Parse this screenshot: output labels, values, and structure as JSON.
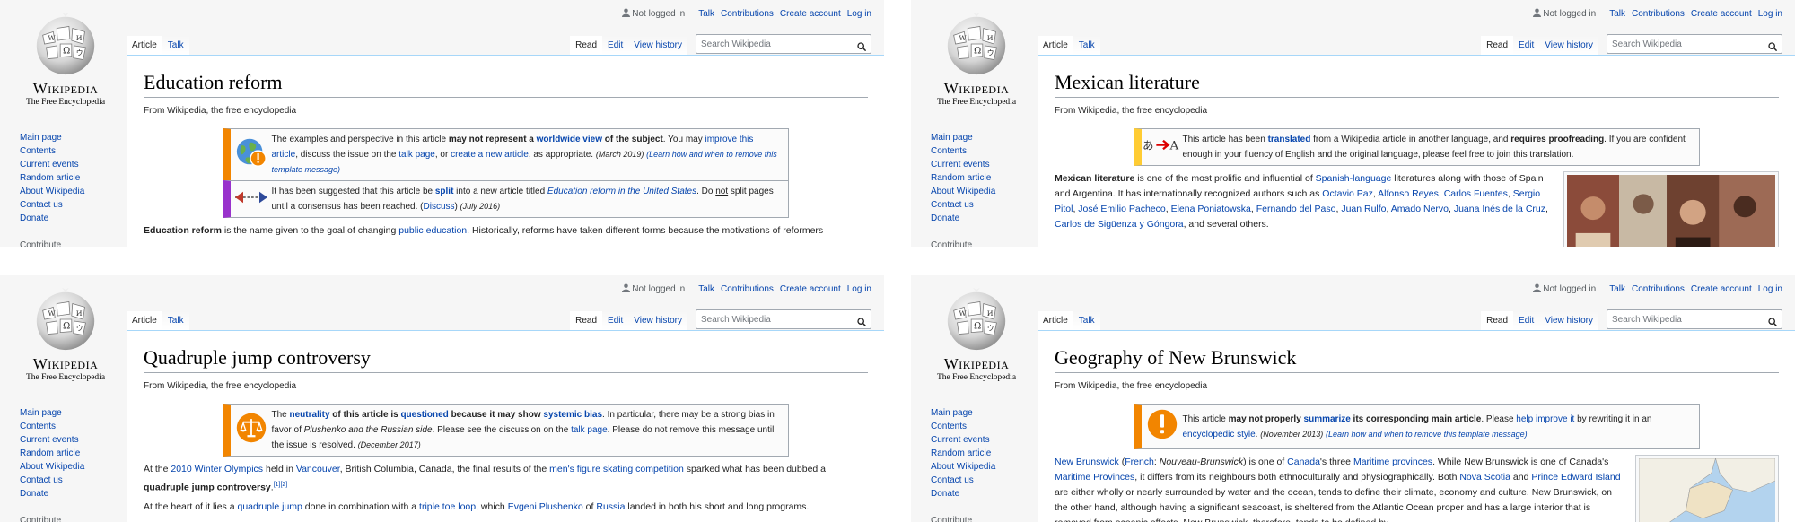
{
  "common": {
    "wordmark": "Wikipedia",
    "tagline": "The Free Encyclopedia",
    "sidebar": {
      "links": [
        "Main page",
        "Contents",
        "Current events",
        "Random article",
        "About Wikipedia",
        "Contact us",
        "Donate"
      ],
      "section": "Contribute"
    },
    "personal": {
      "not_logged": "Not logged in",
      "talk": "Talk",
      "contributions": "Contributions",
      "create_account": "Create account",
      "log_in": "Log in"
    },
    "tabs": {
      "article": "Article",
      "talk": "Talk",
      "read": "Read",
      "edit": "Edit",
      "view_history": "View history"
    },
    "search_placeholder": "Search Wikipedia",
    "site_sub": "From Wikipedia, the free encyclopedia"
  },
  "panels": [
    {
      "title": "Education reform",
      "notices": [
        {
          "icon": "globe-warning-icon",
          "runs": [
            {
              "t": "The examples and perspective in this article "
            },
            {
              "t": "may not represent a ",
              "s": "b"
            },
            {
              "t": "worldwide view",
              "s": "bl"
            },
            {
              "t": " of the subject",
              "s": "b"
            },
            {
              "t": ". You may "
            },
            {
              "t": "improve this article",
              "s": "l"
            },
            {
              "t": ", discuss the issue on the "
            },
            {
              "t": "talk page",
              "s": "l"
            },
            {
              "t": ", or "
            },
            {
              "t": "create a new article",
              "s": "l"
            },
            {
              "t": ", as appropriate. "
            },
            {
              "t": "(March 2019)",
              "s": "d"
            },
            {
              "t": " "
            },
            {
              "t": "(Learn how and when to remove this template message)",
              "s": "ld"
            }
          ]
        },
        {
          "icon": "split-arrows-icon",
          "type": "move",
          "runs": [
            {
              "t": "It has been suggested that this article be "
            },
            {
              "t": "split",
              "s": "bl"
            },
            {
              "t": " into a new article titled "
            },
            {
              "t": "Education reform in the United States",
              "s": "il"
            },
            {
              "t": ". Do "
            },
            {
              "t": "not",
              "s": "u"
            },
            {
              "t": " split pages until a consensus has been reached. ("
            },
            {
              "t": "Discuss",
              "s": "l"
            },
            {
              "t": ") "
            },
            {
              "t": "(July 2016)",
              "s": "d"
            }
          ]
        }
      ],
      "paragraphs": [
        [
          {
            "t": "Education reform",
            "s": "b"
          },
          {
            "t": " is the name given to the goal of changing "
          },
          {
            "t": "public education",
            "s": "l"
          },
          {
            "t": ". Historically, reforms have taken different forms because the motivations of reformers"
          }
        ]
      ]
    },
    {
      "title": "Mexican literature",
      "notices": [
        {
          "icon": "translate-icon",
          "type": "style",
          "runs": [
            {
              "t": "This article has been "
            },
            {
              "t": "translated",
              "s": "bl"
            },
            {
              "t": " from a Wikipedia article in another language, and "
            },
            {
              "t": "requires proofreading",
              "s": "b"
            },
            {
              "t": ". If you are confident enough in your fluency of English and the original language, please feel free to join this translation."
            }
          ]
        }
      ],
      "thumb": true,
      "paragraphs": [
        [
          {
            "t": "Mexican literature",
            "s": "b"
          },
          {
            "t": " is one of the most prolific and influential of "
          },
          {
            "t": "Spanish-language",
            "s": "l"
          },
          {
            "t": " literatures along with those of Spain and Argentina. It has internationally recognized authors such as "
          },
          {
            "t": "Octavio Paz",
            "s": "l"
          },
          {
            "t": ", "
          },
          {
            "t": "Alfonso Reyes",
            "s": "l"
          },
          {
            "t": ", "
          },
          {
            "t": "Carlos Fuentes",
            "s": "l"
          },
          {
            "t": ", "
          },
          {
            "t": "Sergio Pitol",
            "s": "l"
          },
          {
            "t": ", "
          },
          {
            "t": "José Emilio Pacheco",
            "s": "l"
          },
          {
            "t": ", "
          },
          {
            "t": "Elena Poniatowska",
            "s": "l"
          },
          {
            "t": ", "
          },
          {
            "t": "Fernando del Paso",
            "s": "l"
          },
          {
            "t": ", "
          },
          {
            "t": "Juan Rulfo",
            "s": "l"
          },
          {
            "t": ", "
          },
          {
            "t": "Amado Nervo",
            "s": "l"
          },
          {
            "t": ", "
          },
          {
            "t": "Juana Inés de la Cruz",
            "s": "l"
          },
          {
            "t": ", "
          },
          {
            "t": "Carlos de Sigüenza y Góngora",
            "s": "l"
          },
          {
            "t": ", and several others."
          }
        ]
      ]
    },
    {
      "title": "Quadruple jump controversy",
      "notices": [
        {
          "icon": "scales-icon",
          "runs": [
            {
              "t": "The "
            },
            {
              "t": "neutrality",
              "s": "bl"
            },
            {
              "t": " of this article is ",
              "s": "b"
            },
            {
              "t": "questioned",
              "s": "bl"
            },
            {
              "t": " because it may show ",
              "s": "b"
            },
            {
              "t": "systemic bias",
              "s": "bl"
            },
            {
              "t": ". In particular, there may be a strong bias in favor of "
            },
            {
              "t": "Plushenko and the Russian side",
              "s": "i"
            },
            {
              "t": ". Please see the discussion on the "
            },
            {
              "t": "talk page",
              "s": "l"
            },
            {
              "t": ". Please do not remove this message until the issue is resolved. "
            },
            {
              "t": "(December 2017)",
              "s": "d"
            }
          ]
        }
      ],
      "paragraphs": [
        [
          {
            "t": "At the "
          },
          {
            "t": "2010 Winter Olympics",
            "s": "l"
          },
          {
            "t": " held in "
          },
          {
            "t": "Vancouver",
            "s": "l"
          },
          {
            "t": ", British Columbia, Canada, the final results of the "
          },
          {
            "t": "men's figure skating competition",
            "s": "l"
          },
          {
            "t": " sparked what has been dubbed a "
          },
          {
            "t": "quadruple jump controversy",
            "s": "b"
          },
          {
            "t": "."
          },
          {
            "t": "[1][2]",
            "s": "sup"
          }
        ],
        [
          {
            "t": "At the heart of it lies a "
          },
          {
            "t": "quadruple jump",
            "s": "l"
          },
          {
            "t": " done in combination with a "
          },
          {
            "t": "triple toe loop",
            "s": "l"
          },
          {
            "t": ", which "
          },
          {
            "t": "Evgeni Plushenko",
            "s": "l"
          },
          {
            "t": " of "
          },
          {
            "t": "Russia",
            "s": "l"
          },
          {
            "t": " landed in both his short and long programs."
          }
        ]
      ]
    },
    {
      "title": "Geography of New Brunswick",
      "notices": [
        {
          "icon": "exclamation-icon",
          "runs": [
            {
              "t": "This article "
            },
            {
              "t": "may not properly ",
              "s": "b"
            },
            {
              "t": "summarize",
              "s": "bl"
            },
            {
              "t": " its corresponding main article",
              "s": "b"
            },
            {
              "t": ". Please "
            },
            {
              "t": "help improve it",
              "s": "l"
            },
            {
              "t": " by rewriting it in an "
            },
            {
              "t": "encyclopedic style",
              "s": "l"
            },
            {
              "t": ". "
            },
            {
              "t": "(November 2013)",
              "s": "d"
            },
            {
              "t": " "
            },
            {
              "t": "(Learn how and when to remove this template message)",
              "s": "ld"
            }
          ]
        }
      ],
      "map_thumb": true,
      "paragraphs": [
        [
          {
            "t": "New Brunswick",
            "s": "l"
          },
          {
            "t": " ("
          },
          {
            "t": "French",
            "s": "l"
          },
          {
            "t": ": "
          },
          {
            "t": "Nouveau-Brunswick",
            "s": "i"
          },
          {
            "t": ") is one of "
          },
          {
            "t": "Canada",
            "s": "l"
          },
          {
            "t": "'s three "
          },
          {
            "t": "Maritime provinces",
            "s": "l"
          },
          {
            "t": ". While New Brunswick is one of Canada's "
          },
          {
            "t": "Maritime Provinces",
            "s": "l"
          },
          {
            "t": ", it differs from its neighbours both ethnoculturally and physiographically. Both "
          },
          {
            "t": "Nova Scotia",
            "s": "l"
          },
          {
            "t": " and "
          },
          {
            "t": "Prince Edward Island",
            "s": "l"
          },
          {
            "t": " are either wholly or nearly surrounded by water and the ocean, tends to define their climate, economy and culture. New Brunswick, on the other hand, although having a significant seacoast, is sheltered from the Atlantic Ocean proper and has a large interior that is removed from oceanic effects. New Brunswick, therefore, tends to be defined by"
          }
        ]
      ]
    }
  ]
}
